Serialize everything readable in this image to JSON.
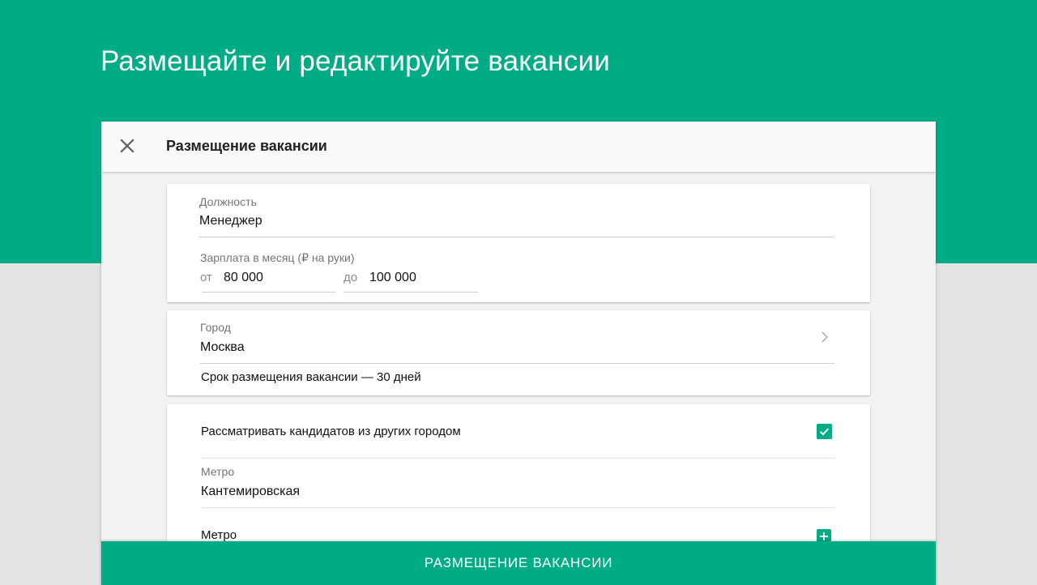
{
  "hero": {
    "title": "Размещайте и редактируйте вакансии"
  },
  "dialog": {
    "title": "Размещение вакансии",
    "close_icon": "close-icon"
  },
  "position": {
    "label": "Должность",
    "value": "Менеджер"
  },
  "salary": {
    "label": "Зарплата в месяц (₽ на руки)",
    "from_prefix": "от",
    "from_value": "80 000",
    "to_prefix": "до",
    "to_value": "100 000"
  },
  "city": {
    "label": "Город",
    "value": "Москва",
    "chevron_icon": "chevron-right-icon",
    "duration_text": "Срок размещения вакансии — 30 дней"
  },
  "candidates": {
    "other_cities_label": "Рассматривать кандидатов из других городом",
    "other_cities_checked": true
  },
  "metro": {
    "label": "Метро",
    "value": "Кантемировская",
    "add_label": "Метро",
    "add_icon": "plus-icon"
  },
  "submit": {
    "label": "РАЗМЕЩЕНИЕ ВАКАНСИИ"
  },
  "colors": {
    "accent": "#00ac86",
    "page_bg": "#e2e3e3",
    "sheet_bg": "#f2f2f2"
  }
}
